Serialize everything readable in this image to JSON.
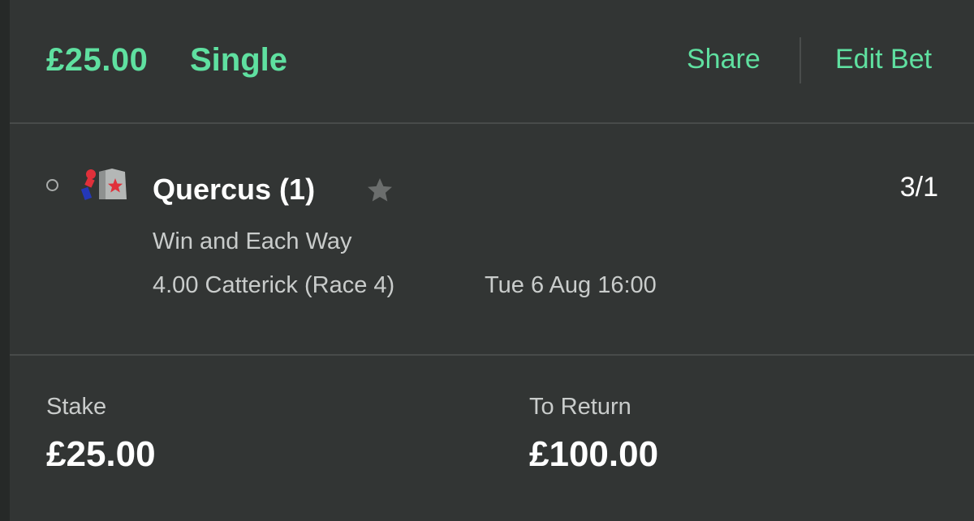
{
  "header": {
    "amount": "£25.00",
    "bet_type": "Single",
    "share_label": "Share",
    "edit_label": "Edit Bet"
  },
  "selection": {
    "name": "Quercus (1)",
    "odds": "3/1",
    "market": "Win and Each Way",
    "event": "4.00 Catterick (Race 4)",
    "event_time": "Tue 6 Aug 16:00",
    "icons": {
      "status": "radio-circle-icon",
      "silks": "jockey-silks-icon",
      "favourite": "star-icon"
    }
  },
  "summary": {
    "stake_label": "Stake",
    "stake_value": "£25.00",
    "return_label": "To Return",
    "return_value": "£100.00"
  },
  "colors": {
    "accent": "#5fe0a0",
    "background": "#323534",
    "text_primary": "#ffffff",
    "text_secondary": "#c9cccb"
  }
}
